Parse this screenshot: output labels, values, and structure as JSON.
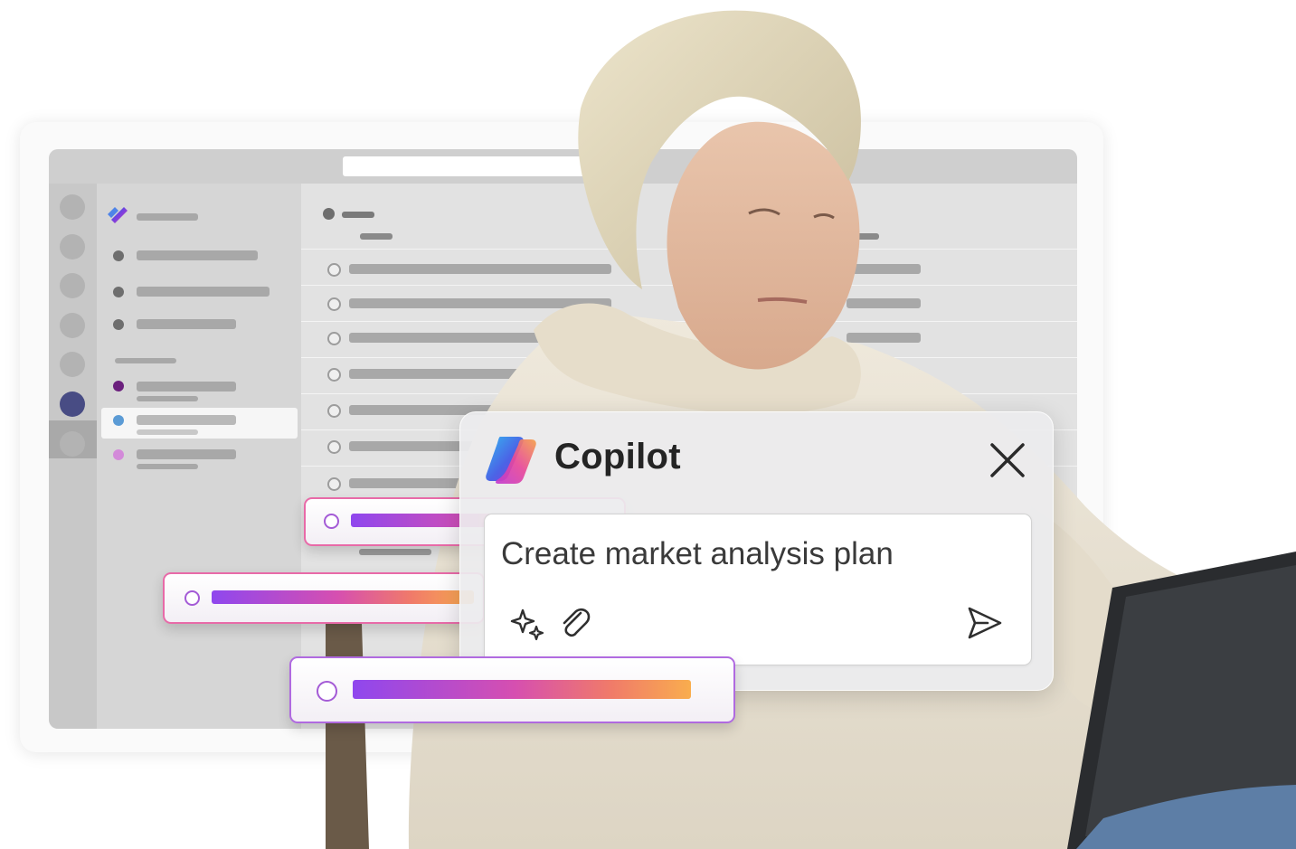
{
  "copilot": {
    "title": "Copilot",
    "prompt": "Create market analysis plan",
    "icons": {
      "logo": "copilot-logo-icon",
      "close": "close-icon",
      "sparkle": "sparkle-icon",
      "attach": "paperclip-icon",
      "send": "send-icon"
    }
  },
  "colors": {
    "accent_violet": "#8f47ee",
    "accent_pink": "#d64fb0",
    "accent_orange": "#f9ad4e",
    "rail_active": "#484c84",
    "nav_bullets": [
      "#6e6e6e",
      "#6e6e6e",
      "#6e6e6e",
      "#6b1f7d",
      "#5b9bd5",
      "#d38ad9"
    ]
  }
}
